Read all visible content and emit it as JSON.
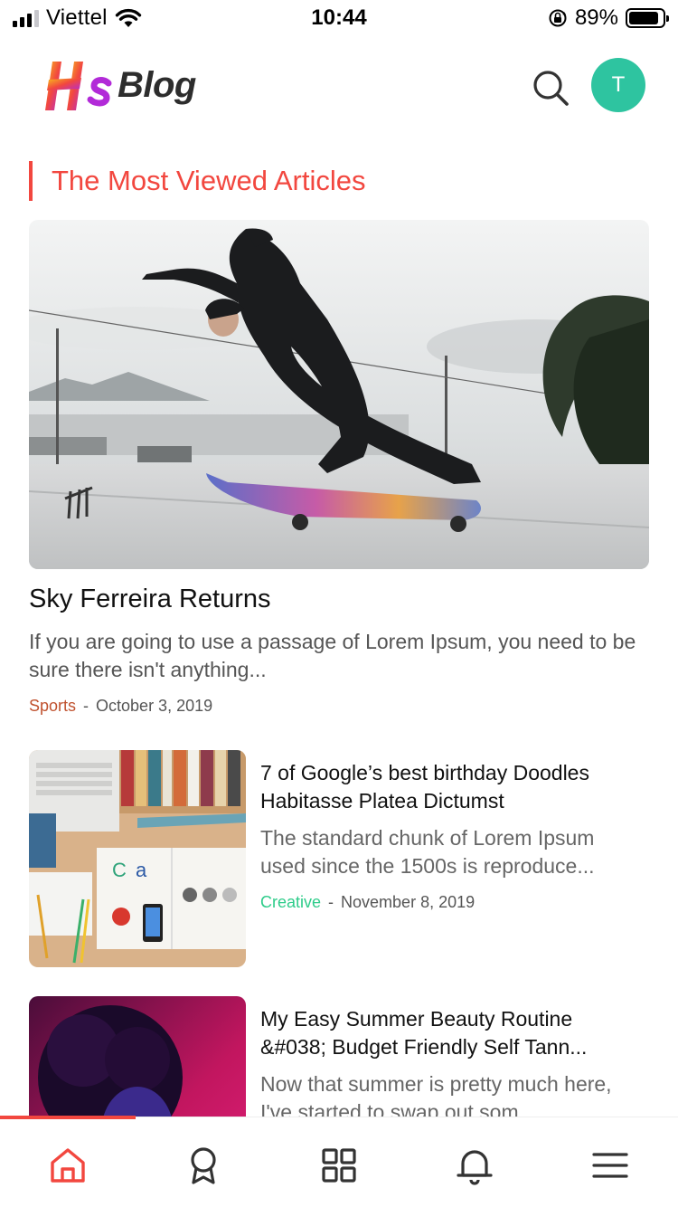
{
  "status_bar": {
    "carrier": "Viettel",
    "time": "10:44",
    "battery_percent": "89%",
    "battery_level": 0.89,
    "icons": [
      "signal-icon",
      "wifi-icon",
      "rotation-lock-icon",
      "battery-icon"
    ]
  },
  "header": {
    "logo_text": "Blog",
    "logo_letters": "HS",
    "avatar_initial": "T",
    "avatar_color": "#2ec4a0",
    "search_icon": "search-icon"
  },
  "section": {
    "title": "The Most Viewed Articles",
    "accent_color": "#f2473f"
  },
  "featured": {
    "title": "Sky Ferreira Returns",
    "excerpt": "If you are going to use a passage of Lorem Ipsum, you need to be sure there isn't anything...",
    "category": "Sports",
    "separator": "-",
    "date": "October 3, 2019"
  },
  "articles": [
    {
      "title": "7 of Google’s best birthday Doodles Habitasse Platea Dictumst",
      "excerpt": "The standard chunk of Lorem Ipsum used since the 1500s is reproduce...",
      "category": "Creative",
      "separator": "-",
      "date": "November 8, 2019"
    },
    {
      "title": "My Easy Summer Beauty Routine &#038; Budget Friendly Self Tann...",
      "excerpt": "Now that summer is pretty much here, I've started to swap out som..."
    }
  ],
  "bottom_nav": {
    "items": [
      "home-icon",
      "award-icon",
      "grid-icon",
      "bell-icon",
      "menu-icon"
    ],
    "active": "home-icon",
    "active_color": "#f2473f",
    "scroll_progress": 0.2
  }
}
